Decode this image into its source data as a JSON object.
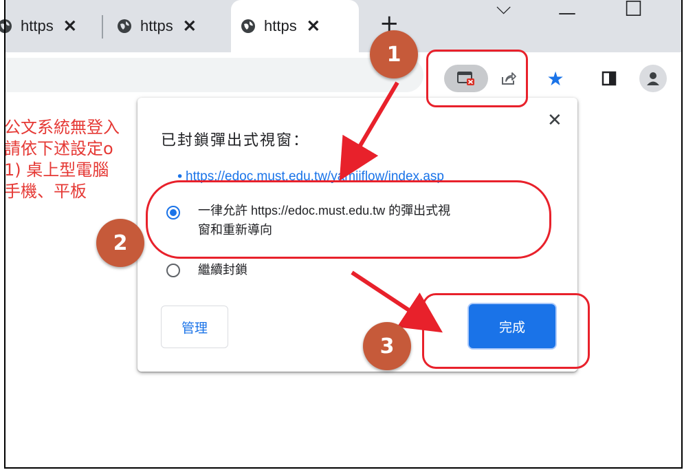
{
  "browser": {
    "tabs": [
      {
        "title": "https",
        "close": "✕",
        "active": false
      },
      {
        "title": "https",
        "close": "✕",
        "active": false
      },
      {
        "title": "https",
        "close": "✕",
        "active": true
      }
    ],
    "new_tab": "+",
    "window_controls": {
      "dropdown": "⌵",
      "minimize": "—",
      "maximize": "☐"
    }
  },
  "toolbar": {
    "icons": [
      "popup-blocked-icon",
      "share-icon",
      "bookmark-star-icon",
      "side-panel-icon",
      "profile-icon"
    ]
  },
  "page": {
    "lines": [
      "公文系統無登入",
      "請依下述設定o",
      "1) 桌上型電腦",
      "手機、平板"
    ]
  },
  "popup": {
    "title": "已封鎖彈出式視窗：",
    "close": "✕",
    "blocked_link": "https://edoc.must.edu.tw/yamiiflow/index.asp",
    "options": [
      {
        "label_line1": "一律允許 https://edoc.must.edu.tw 的彈出式視",
        "label_line2": "窗和重新導向",
        "selected": true
      },
      {
        "label_line1": "繼續封鎖",
        "label_line2": "",
        "selected": false
      }
    ],
    "manage_label": "管理",
    "done_label": "完成"
  },
  "annotations": {
    "markers": [
      "1",
      "2",
      "3"
    ],
    "highlight_color": "#e8212b",
    "marker_color": "#c65a3a"
  },
  "colors": {
    "accent": "#1a73e8",
    "page_text": "#e53935"
  }
}
